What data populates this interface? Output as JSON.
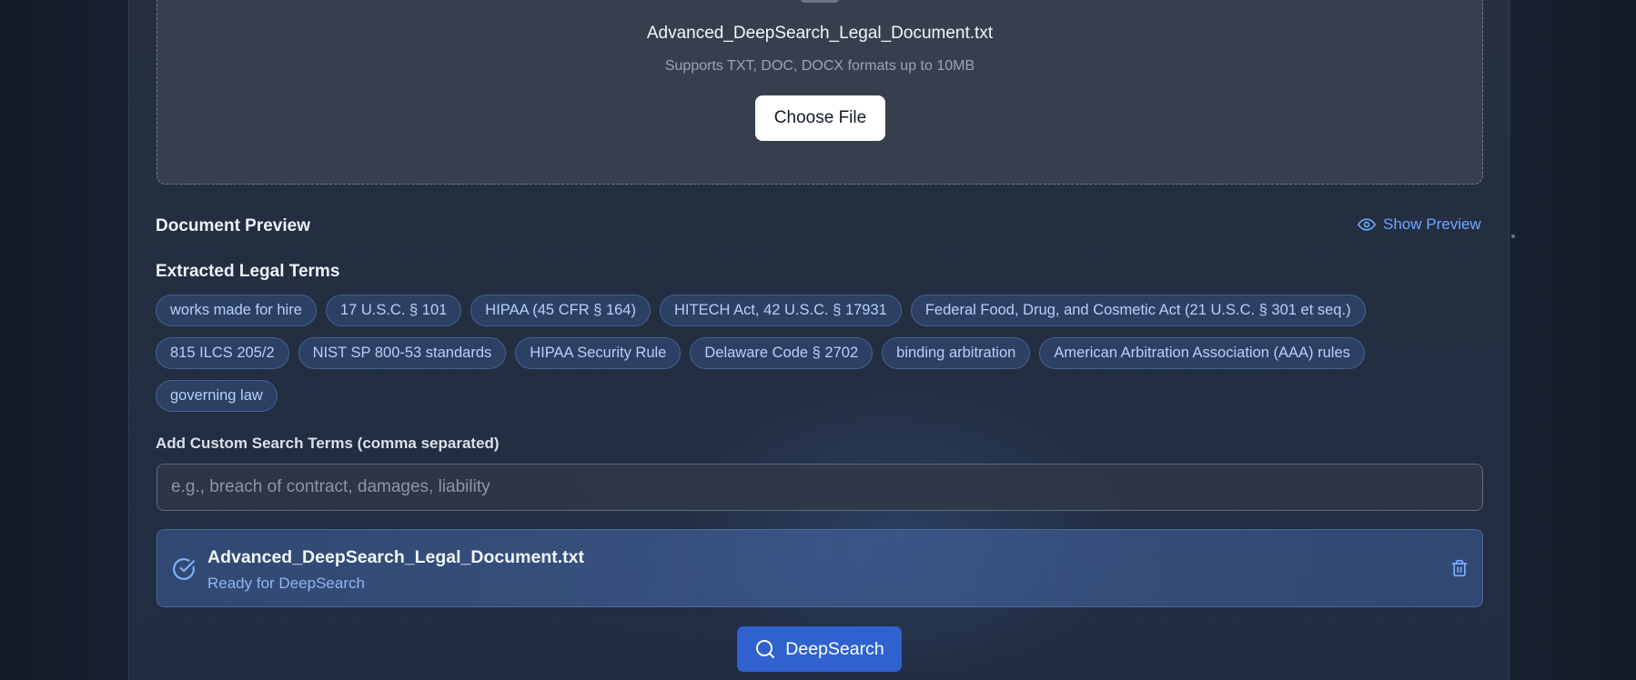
{
  "upload": {
    "filename": "Advanced_DeepSearch_Legal_Document.txt",
    "supports_text": "Supports TXT, DOC, DOCX formats up to 10MB",
    "choose_label": "Choose File"
  },
  "preview": {
    "title": "Document Preview",
    "toggle_label": "Show Preview",
    "toggle_icon": "eye-icon"
  },
  "legal_terms": {
    "title": "Extracted Legal Terms",
    "items": [
      "works made for hire",
      "17 U.S.C. § 101",
      "HIPAA (45 CFR § 164)",
      "HITECH Act, 42 U.S.C. § 17931",
      "Federal Food, Drug, and Cosmetic Act (21 U.S.C. § 301 et seq.)",
      "815 ILCS 205/2",
      "NIST SP 800-53 standards",
      "HIPAA Security Rule",
      "Delaware Code § 2702",
      "binding arbitration",
      "American Arbitration Association (AAA) rules",
      "governing law"
    ]
  },
  "custom_terms": {
    "label": "Add Custom Search Terms (comma separated)",
    "placeholder": "e.g., breach of contract, damages, liability",
    "value": ""
  },
  "file_card": {
    "name": "Advanced_DeepSearch_Legal_Document.txt",
    "status": "Ready for DeepSearch",
    "status_icon": "check-circle-icon",
    "delete_icon": "trash-icon"
  },
  "action": {
    "label": "DeepSearch",
    "icon": "search-icon"
  },
  "colors": {
    "accent": "#2f62cf",
    "link": "#6ea8ff",
    "tag_text": "#b7d0f5",
    "background": "#1a2537"
  }
}
